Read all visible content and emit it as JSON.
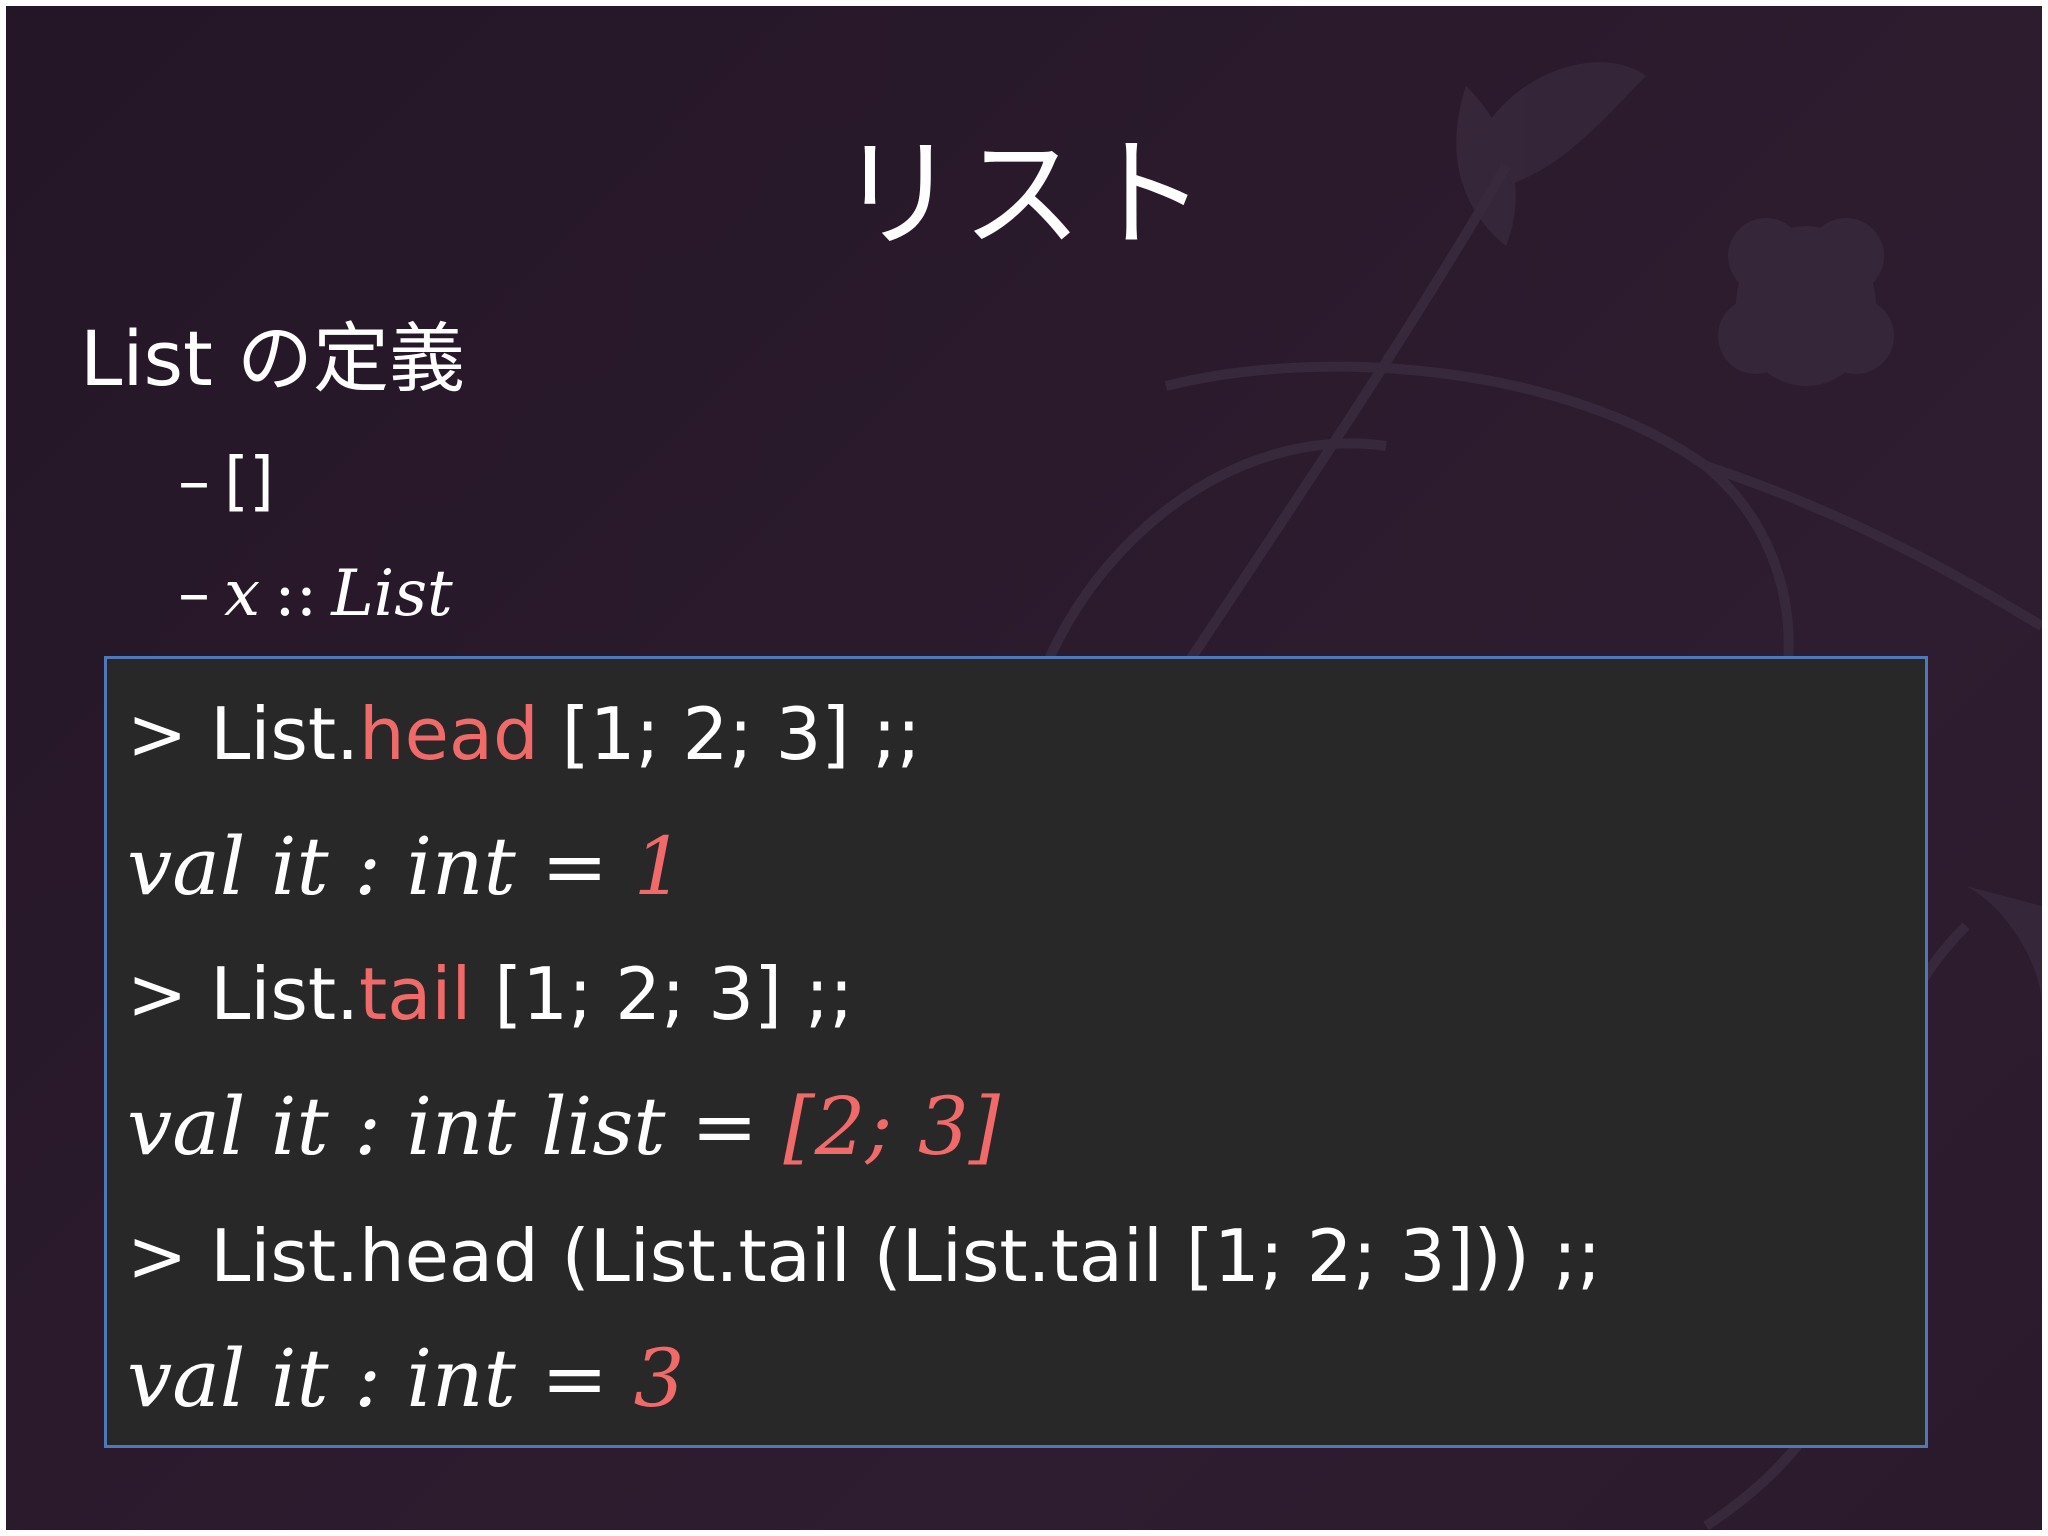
{
  "slide": {
    "title": "リスト",
    "bullet": "List の定義",
    "sub_items": [
      {
        "dash": "–",
        "text": "[]"
      },
      {
        "dash": "–",
        "var": "x",
        "op": "::",
        "type": "List"
      }
    ]
  },
  "code": {
    "lines": [
      {
        "prefix": "> List.",
        "highlight": "head",
        "suffix": " [1; 2; 3] ;;"
      },
      {
        "prefix": "val it : int = ",
        "highlight": "1"
      },
      {
        "prefix": "> List.",
        "highlight": "tail",
        "suffix": " [1; 2; 3] ;;"
      },
      {
        "prefix": "val it : int list = ",
        "highlight": "[2; 3]"
      },
      {
        "prefix": "> List.head (List.tail (List.tail [1; 2; 3])) ;;"
      },
      {
        "prefix": "val it : int = ",
        "highlight": "3"
      }
    ]
  },
  "colors": {
    "background": "#2a1a2c",
    "code_background": "#282828",
    "code_border": "#4f79b6",
    "highlight": "#f06a6a",
    "text": "#ffffff"
  }
}
